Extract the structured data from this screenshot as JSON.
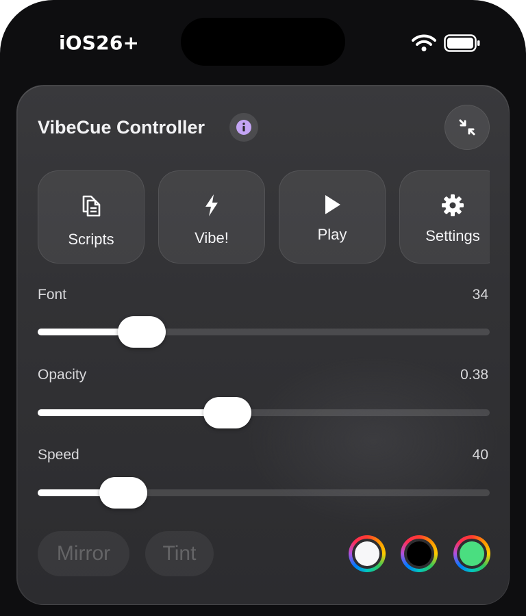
{
  "status": {
    "time": "iOS26+"
  },
  "header": {
    "title": "VibeCue Controller"
  },
  "actions": [
    {
      "label": "Scripts",
      "icon": "documents-icon"
    },
    {
      "label": "Vibe!",
      "icon": "bolt-icon"
    },
    {
      "label": "Play",
      "icon": "play-icon"
    },
    {
      "label": "Settings",
      "icon": "gear-icon"
    }
  ],
  "sliders": {
    "font": {
      "label": "Font",
      "value": "34",
      "fraction": 0.23
    },
    "opacity": {
      "label": "Opacity",
      "value": "0.38",
      "fraction": 0.42
    },
    "speed": {
      "label": "Speed",
      "value": "40",
      "fraction": 0.19
    }
  },
  "toggles": {
    "mirror": "Mirror",
    "tint": "Tint"
  },
  "colors": {
    "white": "#f7f7f9",
    "black": "#000000",
    "green": "#4ade80",
    "info_purple": "#c4a5f5"
  }
}
